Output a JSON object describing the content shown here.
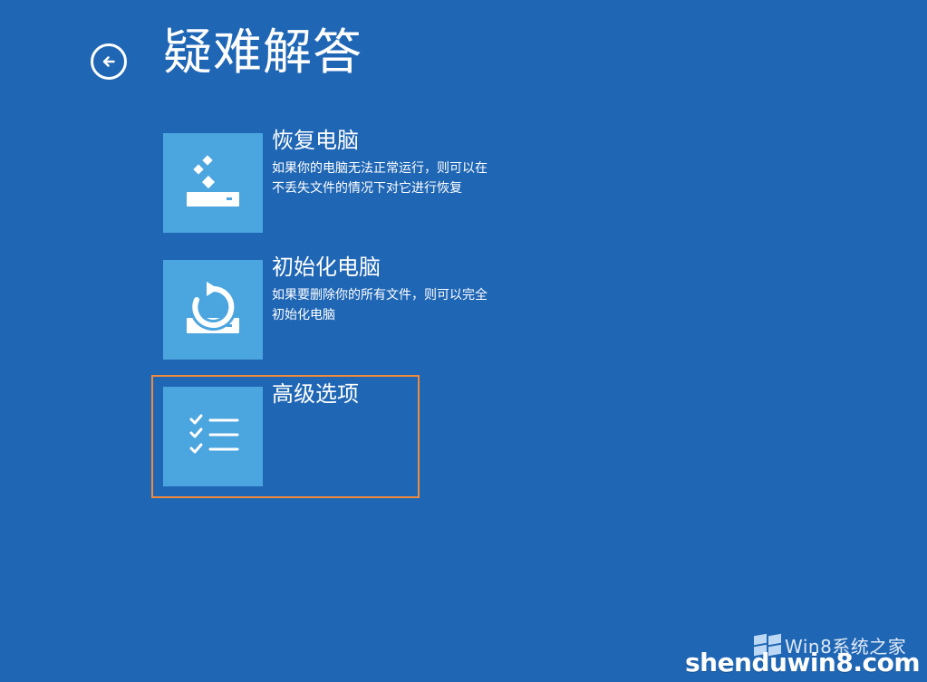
{
  "header": {
    "title": "疑难解答"
  },
  "options": [
    {
      "title": "恢复电脑",
      "description": "如果你的电脑无法正常运行，则可以在不丢失文件的情况下对它进行恢复",
      "icon": "restore-drive-icon"
    },
    {
      "title": "初始化电脑",
      "description": "如果要删除你的所有文件，则可以完全初始化电脑",
      "icon": "reset-drive-icon"
    },
    {
      "title": "高级选项",
      "description": "",
      "icon": "checklist-icon"
    }
  ],
  "watermark": {
    "text": "Win8系统之家",
    "domain": "shenduwin8.com"
  },
  "colors": {
    "background": "#1f66b5",
    "tile": "#4ba5df",
    "selection": "#f08a3d",
    "text": "#ffffff"
  }
}
